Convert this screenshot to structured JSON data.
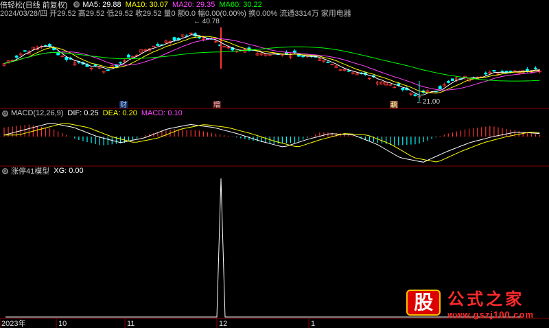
{
  "header": {
    "stock_label": "倍轻松(日线 前复权)",
    "ma5": "MA5: 29.88",
    "ma10": "MA10: 30.07",
    "ma20": "MA20: 29.35",
    "ma60": "MA60: 30.22",
    "info": "2024/03/28/四 开29.52 高29.52 低29.52 收29.52 量0 额0.0 幅0.00(0.00%) 换0.00% 流通3314万 家用电器"
  },
  "price_annotations": {
    "high": "40.78",
    "low": "21.00"
  },
  "event_marks": [
    "财",
    "增",
    "藕"
  ],
  "macd": {
    "label": "MACD(12,26,9)",
    "dif": "DIF: 0.25",
    "dea": "DEA: 0.20",
    "macd": "MACD: 0.10"
  },
  "indicator": {
    "label": "涨停41模型",
    "xg": "XG: 0.00"
  },
  "time_axis": [
    "2023年",
    "10",
    "11",
    "12",
    "1"
  ],
  "watermark": {
    "logo": "股",
    "cn": "公式之家",
    "url": "www.gszj100.com"
  },
  "colors": {
    "ma5": "#ffffff",
    "ma10": "#ffff00",
    "ma20": "#ff44ff",
    "ma60": "#00ff00",
    "up": "#ff3333",
    "down": "#00ffff",
    "grid": "#8b0000"
  },
  "chart_data": [
    {
      "type": "line",
      "description_series": "candlestick close approximation",
      "x": [
        0,
        1,
        2,
        3,
        4,
        5,
        6,
        7,
        8,
        9,
        10,
        11,
        12,
        13,
        14,
        15,
        16,
        17,
        18,
        19,
        20
      ],
      "series": [
        {
          "name": "MA5",
          "values": [
            29.0,
            31,
            33,
            31,
            30,
            33,
            35,
            37,
            38,
            39,
            36,
            34,
            33,
            32,
            31,
            30,
            27,
            24,
            25,
            28,
            29.9
          ]
        },
        {
          "name": "MA60",
          "values": [
            31,
            31,
            32,
            32,
            32,
            32,
            33,
            33,
            33,
            33,
            33,
            33,
            32,
            32,
            32,
            31,
            31,
            30,
            30,
            30,
            30.2
          ]
        }
      ]
    },
    {
      "type": "bar",
      "title": "MACD(12,26,9)",
      "values": [
        0.6,
        0.8,
        0.5,
        -0.2,
        -0.6,
        -0.4,
        0.2,
        0.5,
        0.4,
        0.1,
        -0.2,
        -0.5,
        -0.4,
        0.3,
        0.2,
        -0.3,
        -0.6,
        -0.5,
        0.1,
        0.5,
        0.7,
        0.4,
        0.1
      ],
      "ylim": [
        -1,
        1
      ]
    },
    {
      "type": "line",
      "title": "涨停41模型",
      "values": [
        0,
        0,
        0,
        0,
        0,
        0,
        0,
        0,
        0,
        0,
        0,
        0,
        0,
        0,
        1,
        0,
        0,
        0,
        0,
        0,
        0,
        0,
        0,
        0,
        0,
        0,
        0,
        0,
        0,
        0,
        0,
        0
      ],
      "ylim": [
        0,
        1
      ]
    }
  ]
}
